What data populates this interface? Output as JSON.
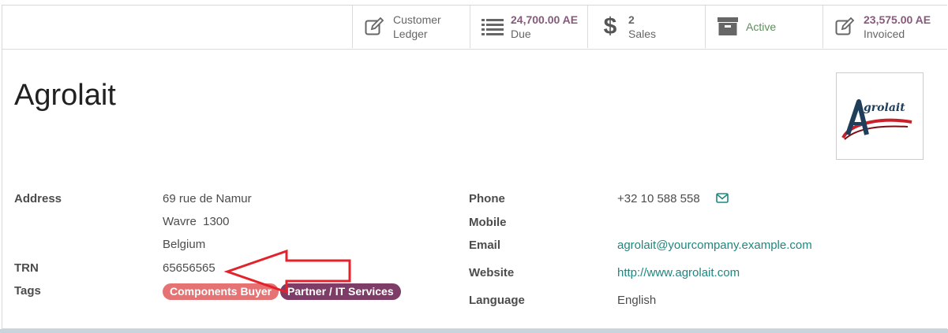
{
  "stat_buttons": [
    {
      "icon": "pencil-square-icon",
      "line1": "Customer",
      "line2": "Ledger",
      "style": "plain"
    },
    {
      "icon": "list-icon",
      "line1": "24,700.00 AE",
      "line2": "Due",
      "style": "value"
    },
    {
      "icon": "dollar-icon",
      "line1": "2",
      "line2": "Sales",
      "style": "value"
    },
    {
      "icon": "archive-icon",
      "line1": "Active",
      "line2": "",
      "style": "green"
    },
    {
      "icon": "pencil-square-icon",
      "line1": "23,575.00 AE",
      "line2": "Invoiced",
      "style": "value"
    }
  ],
  "partner": {
    "name": "Agrolait",
    "logo_text": "Agrolait"
  },
  "fields_left": {
    "address_label": "Address",
    "street": "69 rue de Namur",
    "city_zip": "Wavre  1300",
    "country": "Belgium",
    "trn_label": "TRN",
    "trn_value": "65656565",
    "tags_label": "Tags",
    "tags": [
      "Components Buyer",
      "Partner / IT Services"
    ]
  },
  "fields_right": {
    "phone_label": "Phone",
    "phone_value": "+32 10 588 558",
    "mobile_label": "Mobile",
    "email_label": "Email",
    "email_value": "agrolait@yourcompany.example.com",
    "website_label": "Website",
    "website_value": "http://www.agrolait.com",
    "language_label": "Language",
    "language_value": "English"
  },
  "colors": {
    "tag_components": "#e57373",
    "tag_partner": "#7e3d66",
    "annotation_arrow": "#e3232b",
    "link": "#21867e",
    "stat_value": "#875a7b"
  }
}
